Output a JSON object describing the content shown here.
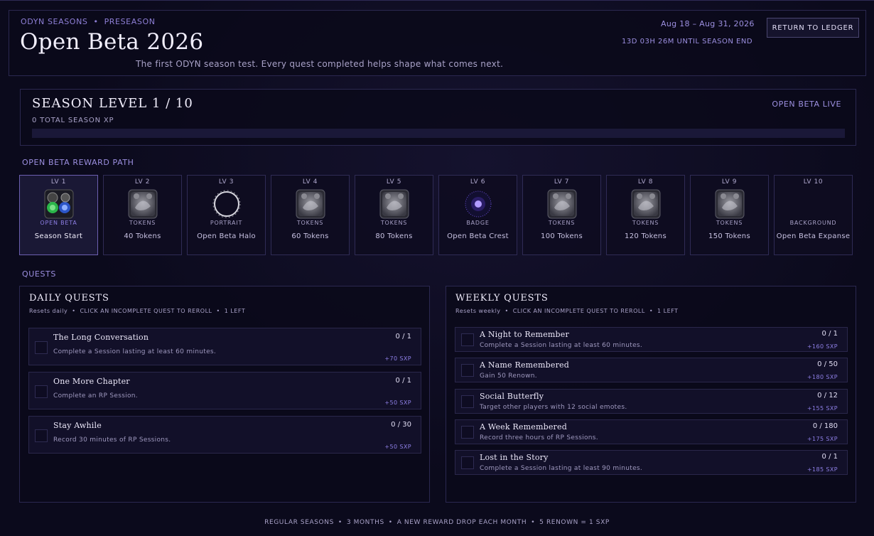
{
  "header": {
    "eyebrow_left": "ODYN SEASONS",
    "eyebrow_right": "PRESEASON",
    "title": "Open Beta 2026",
    "subtitle": "The first ODYN season test. Every quest completed helps shape what comes next.",
    "dates": "Aug 18 – Aug 31, 2026",
    "countdown": "13D 03H 26M UNTIL SEASON END",
    "return_label": "RETURN TO LEDGER"
  },
  "season": {
    "level_title": "SEASON LEVEL 1 / 10",
    "total_xp": "0 TOTAL SEASON XP",
    "status": "OPEN BETA LIVE",
    "progress": 0
  },
  "reward_path": {
    "label": "OPEN BETA REWARD PATH",
    "rewards": [
      {
        "level": "LV 1",
        "type": "OPEN BETA",
        "name": "Season Start",
        "icon": "open-beta-emblem-icon"
      },
      {
        "level": "LV 2",
        "type": "TOKENS",
        "name": "40 Tokens",
        "icon": "tokens-icon"
      },
      {
        "level": "LV 3",
        "type": "PORTRAIT",
        "name": "Open Beta Halo",
        "icon": "halo-portrait-icon"
      },
      {
        "level": "LV 4",
        "type": "TOKENS",
        "name": "60 Tokens",
        "icon": "tokens-icon"
      },
      {
        "level": "LV 5",
        "type": "TOKENS",
        "name": "80 Tokens",
        "icon": "tokens-icon"
      },
      {
        "level": "LV 6",
        "type": "BADGE",
        "name": "Open Beta Crest",
        "icon": "crest-badge-icon"
      },
      {
        "level": "LV 7",
        "type": "TOKENS",
        "name": "100 Tokens",
        "icon": "tokens-icon"
      },
      {
        "level": "LV 8",
        "type": "TOKENS",
        "name": "120 Tokens",
        "icon": "tokens-icon"
      },
      {
        "level": "LV 9",
        "type": "TOKENS",
        "name": "150 Tokens",
        "icon": "tokens-icon"
      },
      {
        "level": "LV 10",
        "type": "BACKGROUND",
        "name": "Open Beta Expanse",
        "icon": ""
      }
    ]
  },
  "quests": {
    "label": "QUESTS",
    "daily": {
      "title": "DAILY QUESTS",
      "resets": "Resets daily",
      "hint": "CLICK AN INCOMPLETE QUEST TO REROLL",
      "left": "1 LEFT",
      "items": [
        {
          "name": "The Long Conversation",
          "desc": "Complete a Session lasting at least 60 minutes.",
          "progress": "0 / 1",
          "xp": "+70 SXP"
        },
        {
          "name": "One More Chapter",
          "desc": "Complete an RP Session.",
          "progress": "0 / 1",
          "xp": "+50 SXP"
        },
        {
          "name": "Stay Awhile",
          "desc": "Record 30 minutes of RP Sessions.",
          "progress": "0 / 30",
          "xp": "+50 SXP"
        }
      ]
    },
    "weekly": {
      "title": "WEEKLY QUESTS",
      "resets": "Resets weekly",
      "hint": "CLICK AN INCOMPLETE QUEST TO REROLL",
      "left": "1 LEFT",
      "items": [
        {
          "name": "A Night to Remember",
          "desc": "Complete a Session lasting at least 60 minutes.",
          "progress": "0 / 1",
          "xp": "+160 SXP"
        },
        {
          "name": "A Name Remembered",
          "desc": "Gain 50 Renown.",
          "progress": "0 / 50",
          "xp": "+180 SXP"
        },
        {
          "name": "Social Butterfly",
          "desc": "Target other players with 12 social emotes.",
          "progress": "0 / 12",
          "xp": "+155 SXP"
        },
        {
          "name": "A Week Remembered",
          "desc": "Record three hours of RP Sessions.",
          "progress": "0 / 180",
          "xp": "+175 SXP"
        },
        {
          "name": "Lost in the Story",
          "desc": "Complete a Session lasting at least 90 minutes.",
          "progress": "0 / 1",
          "xp": "+185 SXP"
        }
      ]
    }
  },
  "footer": {
    "parts": [
      "REGULAR SEASONS",
      "3 MONTHS",
      "A NEW REWARD DROP EACH MONTH",
      "5 RENOWN = 1 SXP"
    ]
  }
}
